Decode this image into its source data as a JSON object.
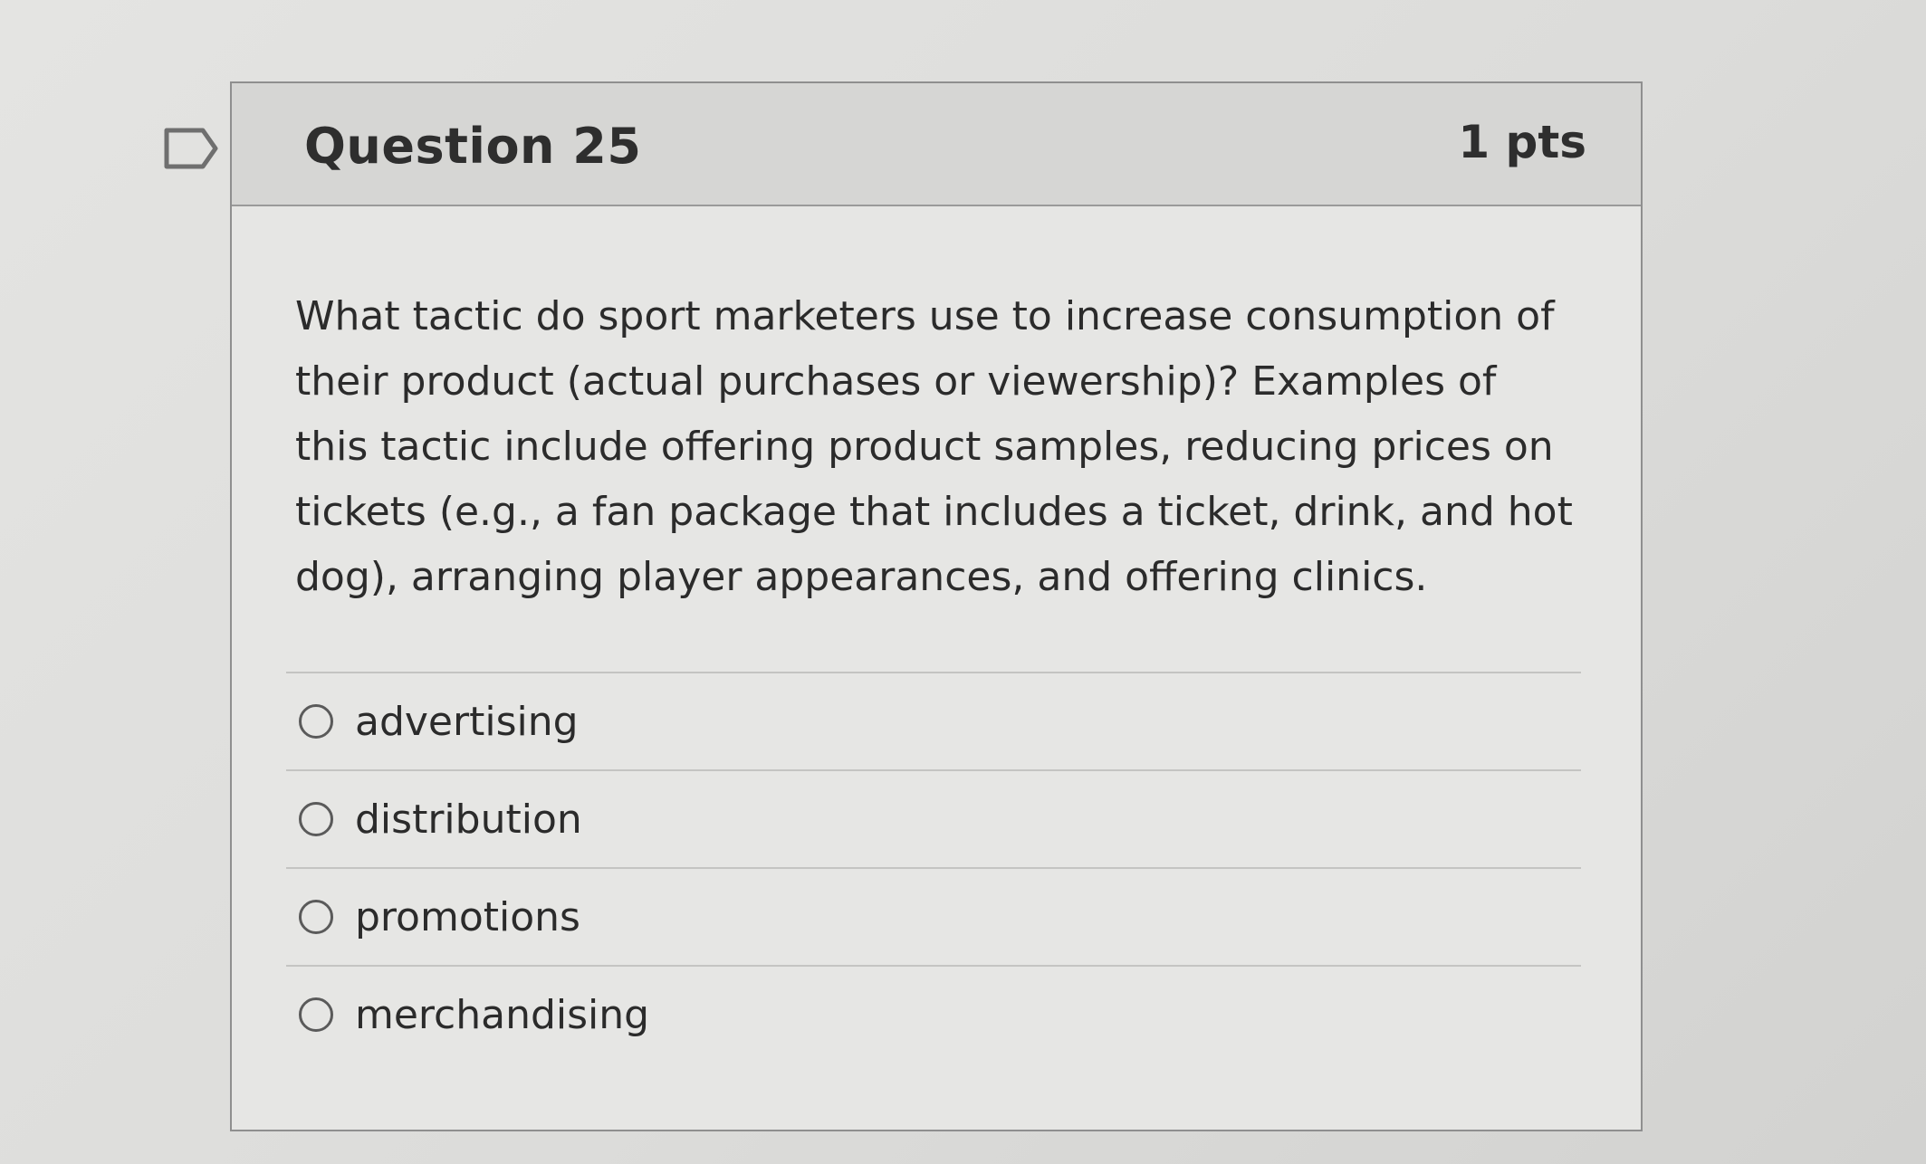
{
  "question": {
    "title": "Question 25",
    "points": "1 pts",
    "flag_icon": "flag-icon",
    "text": "What tactic do sport marketers use to increase consumption of their product (actual purchases or viewership)? Examples of this tactic include offering product samples, reducing prices on tickets (e.g., a fan package that includes a ticket, drink, and hot dog), arranging player appearances, and offering clinics.",
    "answers": [
      {
        "label": "advertising"
      },
      {
        "label": "distribution"
      },
      {
        "label": "promotions"
      },
      {
        "label": "merchandising"
      }
    ]
  }
}
